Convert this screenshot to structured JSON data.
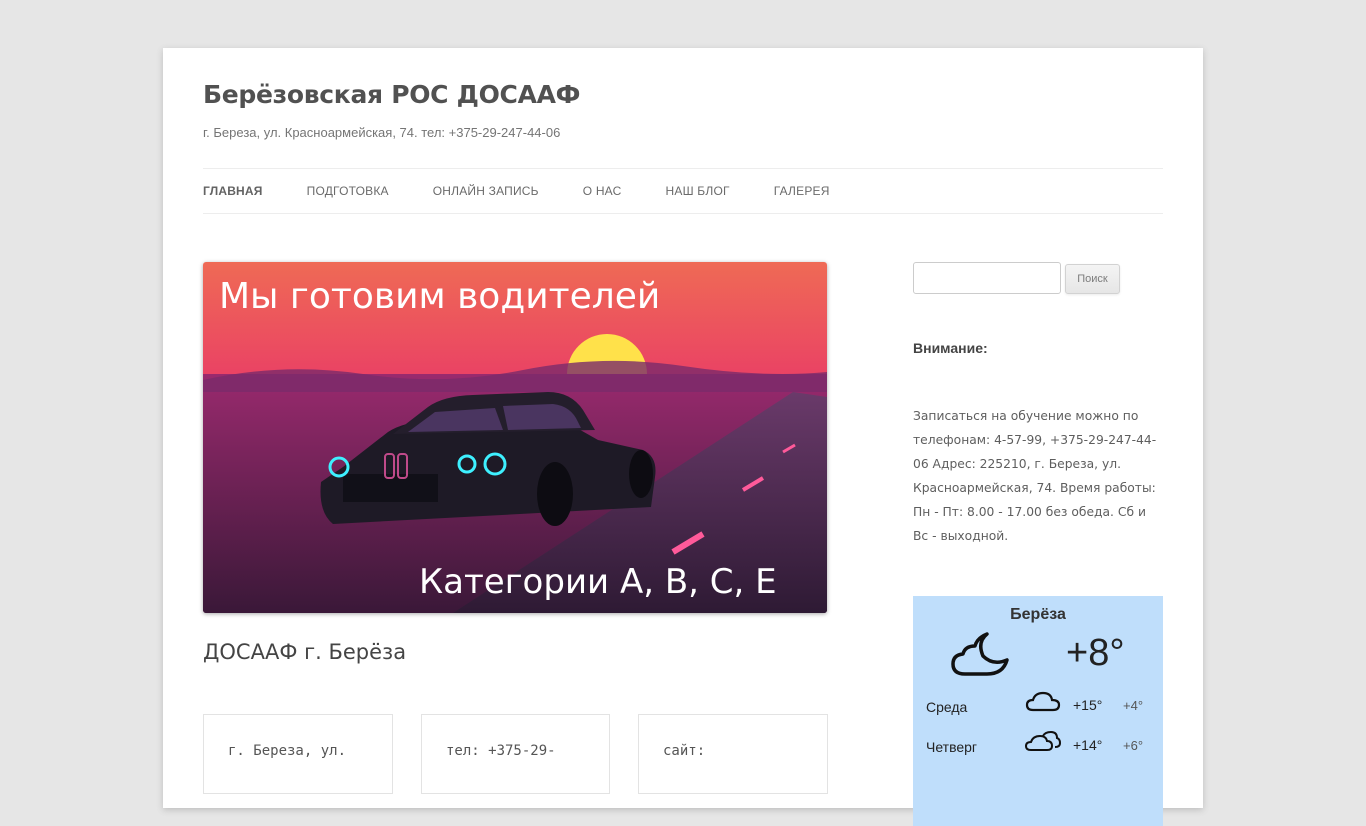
{
  "site": {
    "title": "Берёзовская РОС ДОСААФ",
    "description": "г. Береза, ул. Красноармейская, 74. тел: +375-29-247-44-06"
  },
  "nav": {
    "items": [
      "Главная",
      "Подготовка",
      "Онлайн запись",
      "О нас",
      "Наш блог",
      "Галерея"
    ],
    "active_index": 0
  },
  "banner": {
    "headline": "Мы готовим водителей",
    "subline": "Категории A, B, C, E"
  },
  "post": {
    "title": "ДОСААФ г. Берёза",
    "cards": [
      "г. Береза, ул.",
      "тел: +375-29-",
      "сайт:"
    ]
  },
  "sidebar": {
    "search_placeholder": "",
    "search_button": "Поиск",
    "attention_title": "Внимание:",
    "info_text": "Записаться на обучение можно по телефонам: 4-57-99, +375-29-247-44-06 Адрес: 225210, г. Береза, ул. Красноармейская, 74. Время работы: Пн - Пт: 8.00 - 17.00 без обеда. Сб и Вс - выходной."
  },
  "weather": {
    "city": "Берёза",
    "current_temp": "+8°",
    "current_icon": "night-cloud-icon",
    "forecast": [
      {
        "day": "Среда",
        "hi": "+15°",
        "lo": "+4°",
        "icon": "cloud-icon"
      },
      {
        "day": "Четверг",
        "hi": "+14°",
        "lo": "+6°",
        "icon": "cloudy-icon"
      }
    ],
    "bg_color": "#bfdefb"
  }
}
